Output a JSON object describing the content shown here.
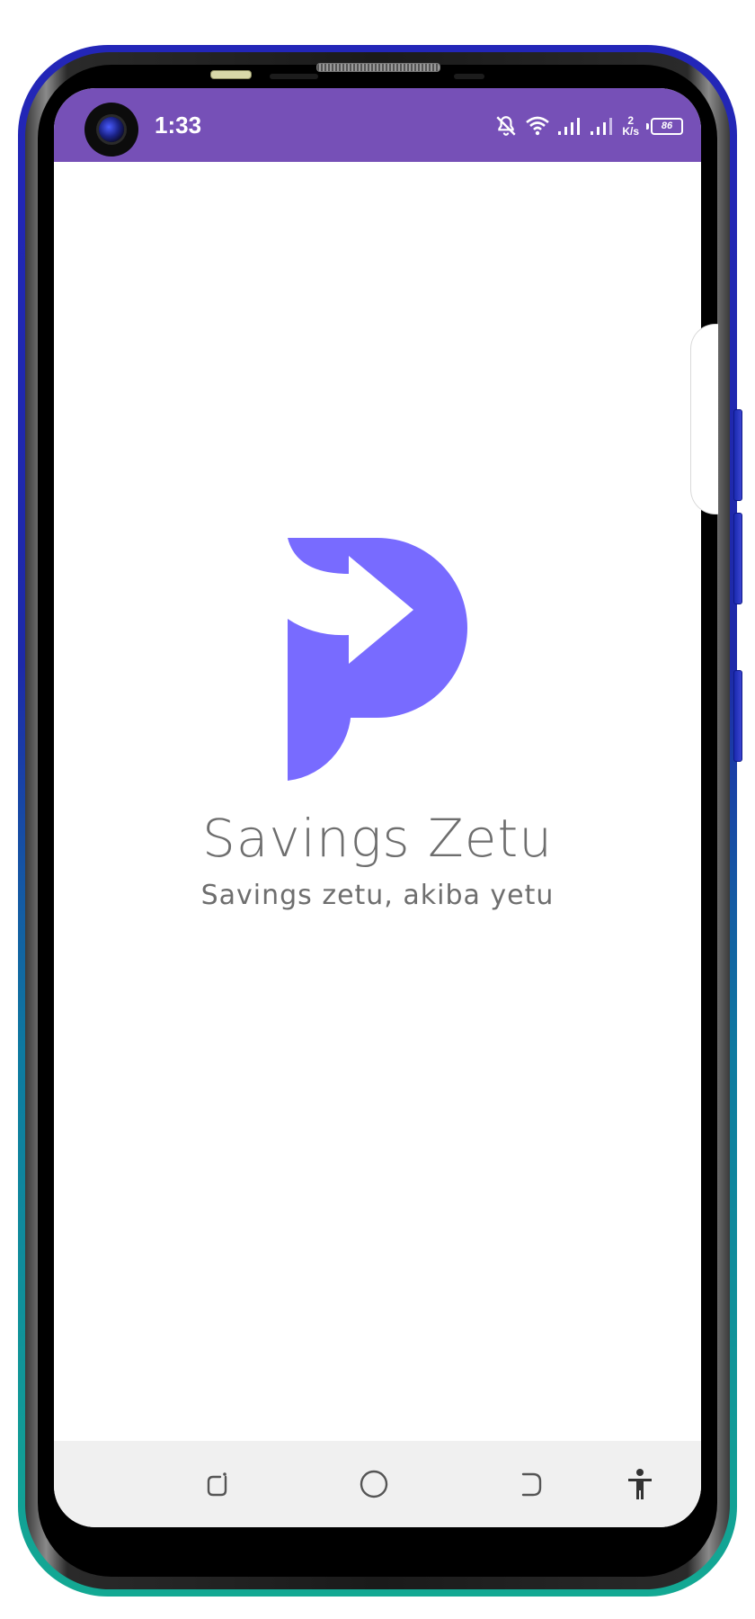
{
  "status_bar": {
    "time": "1:33",
    "net_speed_value": "2",
    "net_speed_unit": "K/s",
    "battery_level": "86",
    "icons": [
      "notifications-off-icon",
      "wifi-icon",
      "signal-1-icon",
      "signal-2-icon",
      "battery-icon"
    ],
    "background_color": "#7650b7"
  },
  "splash": {
    "logo": "app-logo-p-arrow",
    "logo_color": "#786bff",
    "title": "Savings Zetu",
    "tagline": "Savings zetu, akiba yetu",
    "text_color": "#6e6e6e"
  },
  "nav_bar": {
    "buttons": [
      "recent-apps-icon",
      "home-icon",
      "back-icon",
      "accessibility-icon"
    ],
    "background_color": "#f0f0f0"
  }
}
